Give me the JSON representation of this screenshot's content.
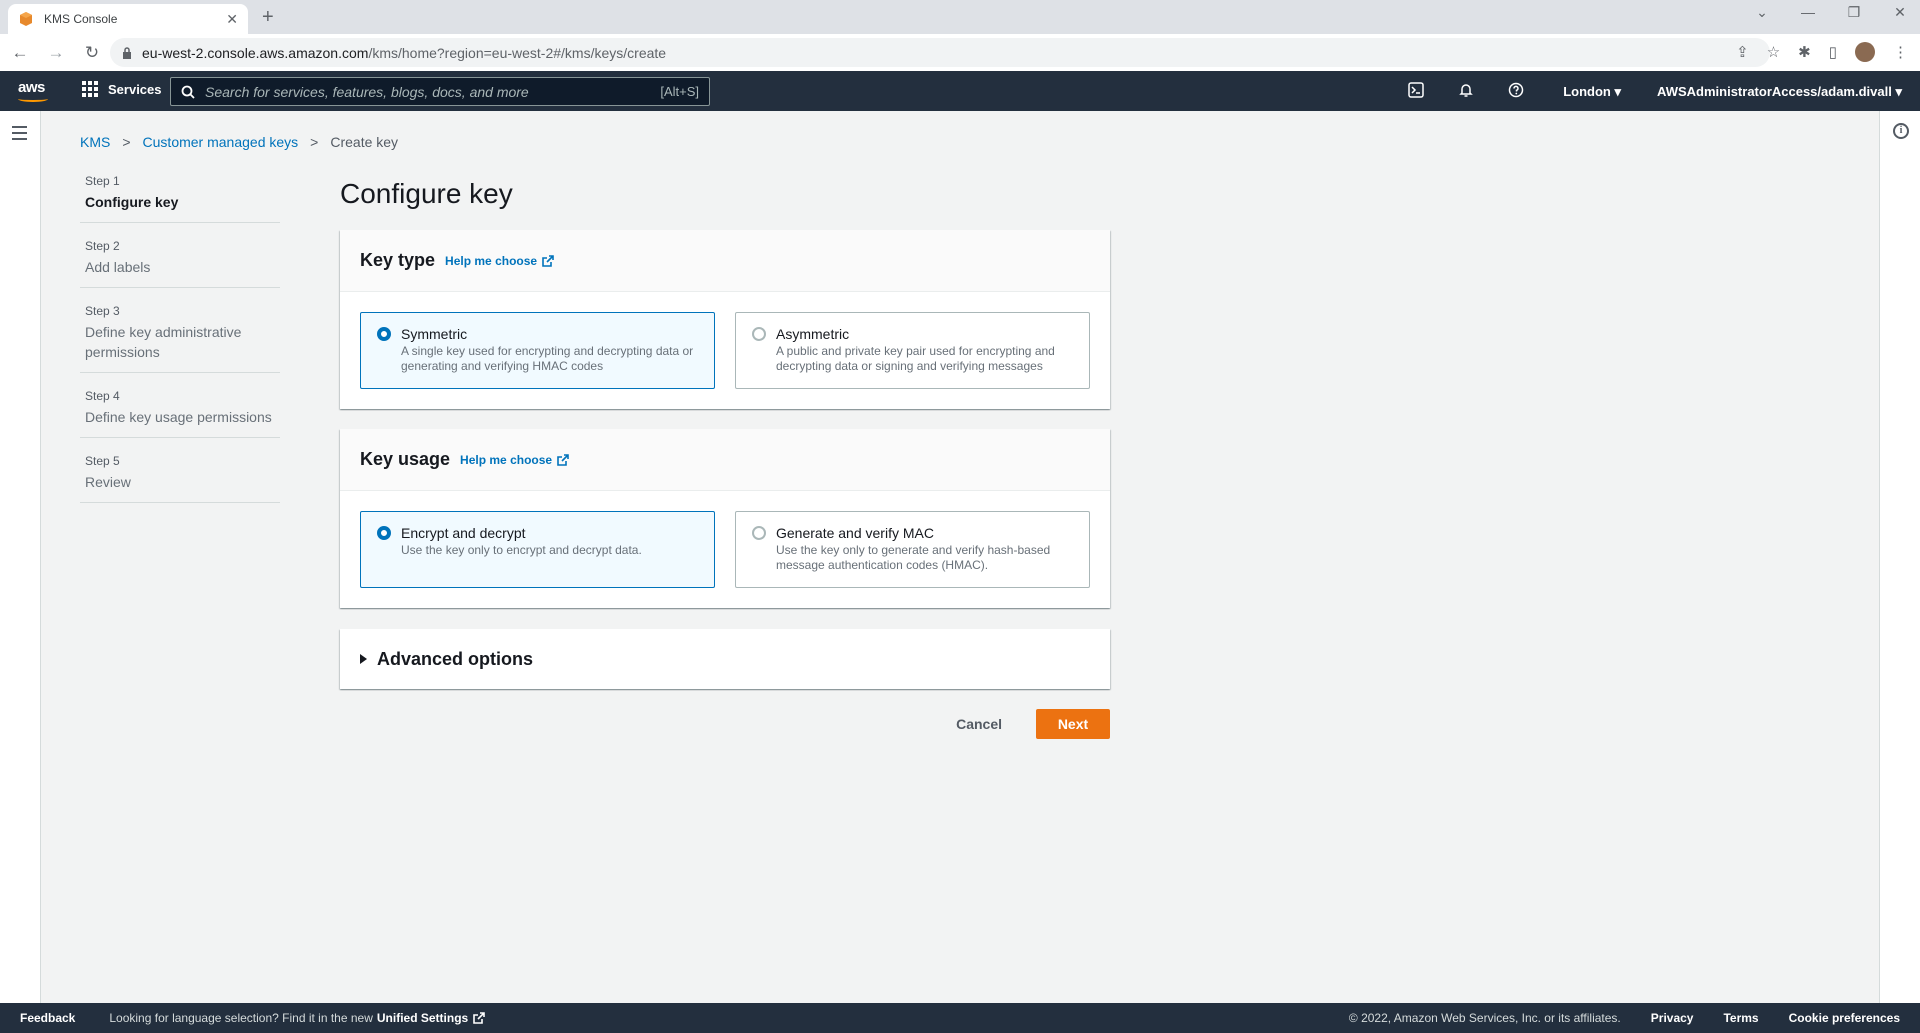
{
  "browser": {
    "tab_title": "KMS Console",
    "url_host": "eu-west-2.console.aws.amazon.com",
    "url_path": "/kms/home?region=eu-west-2#/kms/keys/create"
  },
  "awsnav": {
    "logo": "aws",
    "services_label": "Services",
    "search_placeholder": "Search for services, features, blogs, docs, and more",
    "search_shortcut": "[Alt+S]",
    "region": "London",
    "account": "AWSAdministratorAccess/adam.divall"
  },
  "breadcrumb": {
    "items": [
      "KMS",
      "Customer managed keys"
    ],
    "current": "Create key"
  },
  "steps": [
    {
      "num": "Step 1",
      "title": "Configure key"
    },
    {
      "num": "Step 2",
      "title": "Add labels"
    },
    {
      "num": "Step 3",
      "title": "Define key administrative permissions"
    },
    {
      "num": "Step 4",
      "title": "Define key usage permissions"
    },
    {
      "num": "Step 5",
      "title": "Review"
    }
  ],
  "page_title": "Configure key",
  "key_type": {
    "title": "Key type",
    "help": "Help me choose",
    "options": [
      {
        "title": "Symmetric",
        "desc": "A single key used for encrypting and decrypting data or generating and verifying HMAC codes",
        "selected": true
      },
      {
        "title": "Asymmetric",
        "desc": "A public and private key pair used for encrypting and decrypting data or signing and verifying messages",
        "selected": false
      }
    ]
  },
  "key_usage": {
    "title": "Key usage",
    "help": "Help me choose",
    "options": [
      {
        "title": "Encrypt and decrypt",
        "desc": "Use the key only to encrypt and decrypt data.",
        "selected": true
      },
      {
        "title": "Generate and verify MAC",
        "desc": "Use the key only to generate and verify hash-based message authentication codes (HMAC).",
        "selected": false
      }
    ]
  },
  "advanced": {
    "title": "Advanced options"
  },
  "actions": {
    "cancel": "Cancel",
    "next": "Next"
  },
  "footer": {
    "feedback": "Feedback",
    "lang_text": "Looking for language selection? Find it in the new",
    "unified": "Unified Settings",
    "copyright": "© 2022, Amazon Web Services, Inc. or its affiliates.",
    "privacy": "Privacy",
    "terms": "Terms",
    "cookies": "Cookie preferences"
  },
  "colors": {
    "accent": "#0073bb",
    "primary_button": "#ec7211",
    "nav_bg": "#232f3e"
  }
}
